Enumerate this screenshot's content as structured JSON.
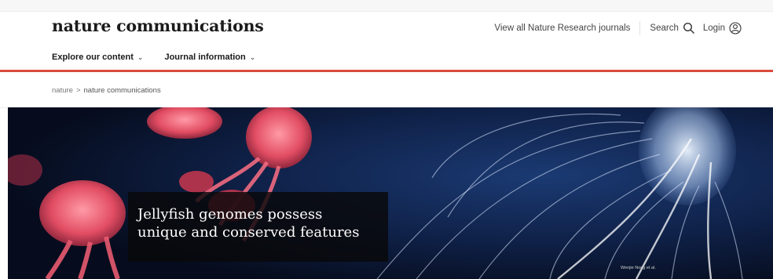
{
  "header": {
    "brand": "nature communications",
    "links": {
      "all_journals": "View all Nature Research journals",
      "search": "Search",
      "login": "Login"
    }
  },
  "nav": {
    "explore": "Explore our content",
    "journal_info": "Journal information"
  },
  "breadcrumb": {
    "root": "nature",
    "separator": ">",
    "current": "nature communications"
  },
  "hero": {
    "title": "Jellyfish genomes possess unique and conserved features",
    "credit": "Wenjie Nong et al."
  },
  "colors": {
    "accent_red": "#d94c3c",
    "hero_bg": "#0a1530"
  },
  "icons": [
    "search-icon",
    "user-icon",
    "chevron-down-icon"
  ]
}
